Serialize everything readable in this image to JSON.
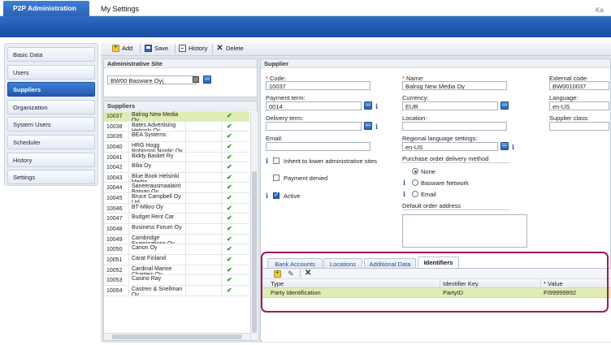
{
  "header": {
    "app_tab": "P2P Administration",
    "my_settings": "My Settings",
    "user_initials": "Ka"
  },
  "nav": {
    "items": [
      {
        "label": "Basic Data"
      },
      {
        "label": "Users"
      },
      {
        "label": "Suppliers"
      },
      {
        "label": "Organization"
      },
      {
        "label": "System Users"
      },
      {
        "label": "Scheduler"
      },
      {
        "label": "History"
      },
      {
        "label": "Settings"
      }
    ],
    "active": "Suppliers"
  },
  "toolbar": {
    "add": "Add",
    "save": "Save",
    "history": "History",
    "delete": "Delete"
  },
  "admin_site": {
    "title": "Administrative Site",
    "value": "BW00 Basware Oyj"
  },
  "suppliers_list": {
    "title": "Suppliers",
    "rows": [
      {
        "code": "10037",
        "name": "Balrog New Media Oy",
        "active": "✔"
      },
      {
        "code": "10038",
        "name": "Bates Advertising Helsinki Oy",
        "active": "✔"
      },
      {
        "code": "10039",
        "name": "BEA Systems",
        "active": "✔"
      },
      {
        "code": "10040",
        "name": "HRG Hogg Robinson Nordic Oy",
        "active": "✔"
      },
      {
        "code": "10041",
        "name": "Biddy Basket Ry",
        "active": "✔"
      },
      {
        "code": "10042",
        "name": "Bilia Oy",
        "active": "✔"
      },
      {
        "code": "10043",
        "name": "Blue Book Helsinki Media",
        "active": "✔"
      },
      {
        "code": "10044",
        "name": "Saneerausmaalaint Boman Oy",
        "active": "✔"
      },
      {
        "code": "10045",
        "name": "Bruce Campbell Oy Ltd.",
        "active": "✔"
      },
      {
        "code": "10046",
        "name": "BT-Mikro Oy",
        "active": "✔"
      },
      {
        "code": "10047",
        "name": "Budget Rent Car",
        "active": "✔"
      },
      {
        "code": "10048",
        "name": "Business Forum Oy",
        "active": "✔"
      },
      {
        "code": "10049",
        "name": "Cambridge Examinations Oy",
        "active": "✔"
      },
      {
        "code": "10050",
        "name": "Canon Oy",
        "active": "✔"
      },
      {
        "code": "10051",
        "name": "Carat Finland",
        "active": "✔"
      },
      {
        "code": "10052",
        "name": "Cardinal Marine Charters Oy",
        "active": "✔"
      },
      {
        "code": "10053",
        "name": "Casino Ray",
        "active": "✔"
      },
      {
        "code": "10054",
        "name": "Castren & Snellman Oy",
        "active": "✔"
      }
    ]
  },
  "supplier": {
    "title": "Supplier",
    "code_label": "Code:",
    "code_value": "10037",
    "name_label": "Name:",
    "name_value": "Balrog New Media Oy",
    "external_code_label": "External code:",
    "external_code_value": "BW0010037",
    "payment_term_label": "Payment term:",
    "payment_term_value": "0014",
    "currency_label": "Currency:",
    "currency_value": "EUR",
    "language_label": "Language:",
    "language_value": "en-US",
    "delivery_term_label": "Delivery term:",
    "delivery_term_value": "",
    "location_label": "Location:",
    "location_value": "",
    "supplier_class_label": "Supplier class:",
    "supplier_class_value": "",
    "email_label": "Email:",
    "email_value": "",
    "regional_label": "Regional language settings:",
    "regional_value": "en-US",
    "inherit_label": "Inherit to lower administrative sites",
    "payment_denied_label": "Payment denied",
    "active_label": "Active",
    "po_delivery_title": "Purchase order delivery method",
    "po_options": [
      "None",
      "Basware Network",
      "Email"
    ],
    "po_selected": "None",
    "default_order_address_label": "Default order address",
    "ellipsis": "..."
  },
  "tabs": {
    "items": [
      "Bank Accounts",
      "Locations",
      "Additional Data",
      "Identifiers"
    ],
    "active": "Identifiers",
    "columns": [
      "Type",
      "Identifier Key",
      "* Value"
    ],
    "rows": [
      {
        "type": "Party Identification",
        "key": "PartyID",
        "value": "FI99999992"
      }
    ]
  }
}
